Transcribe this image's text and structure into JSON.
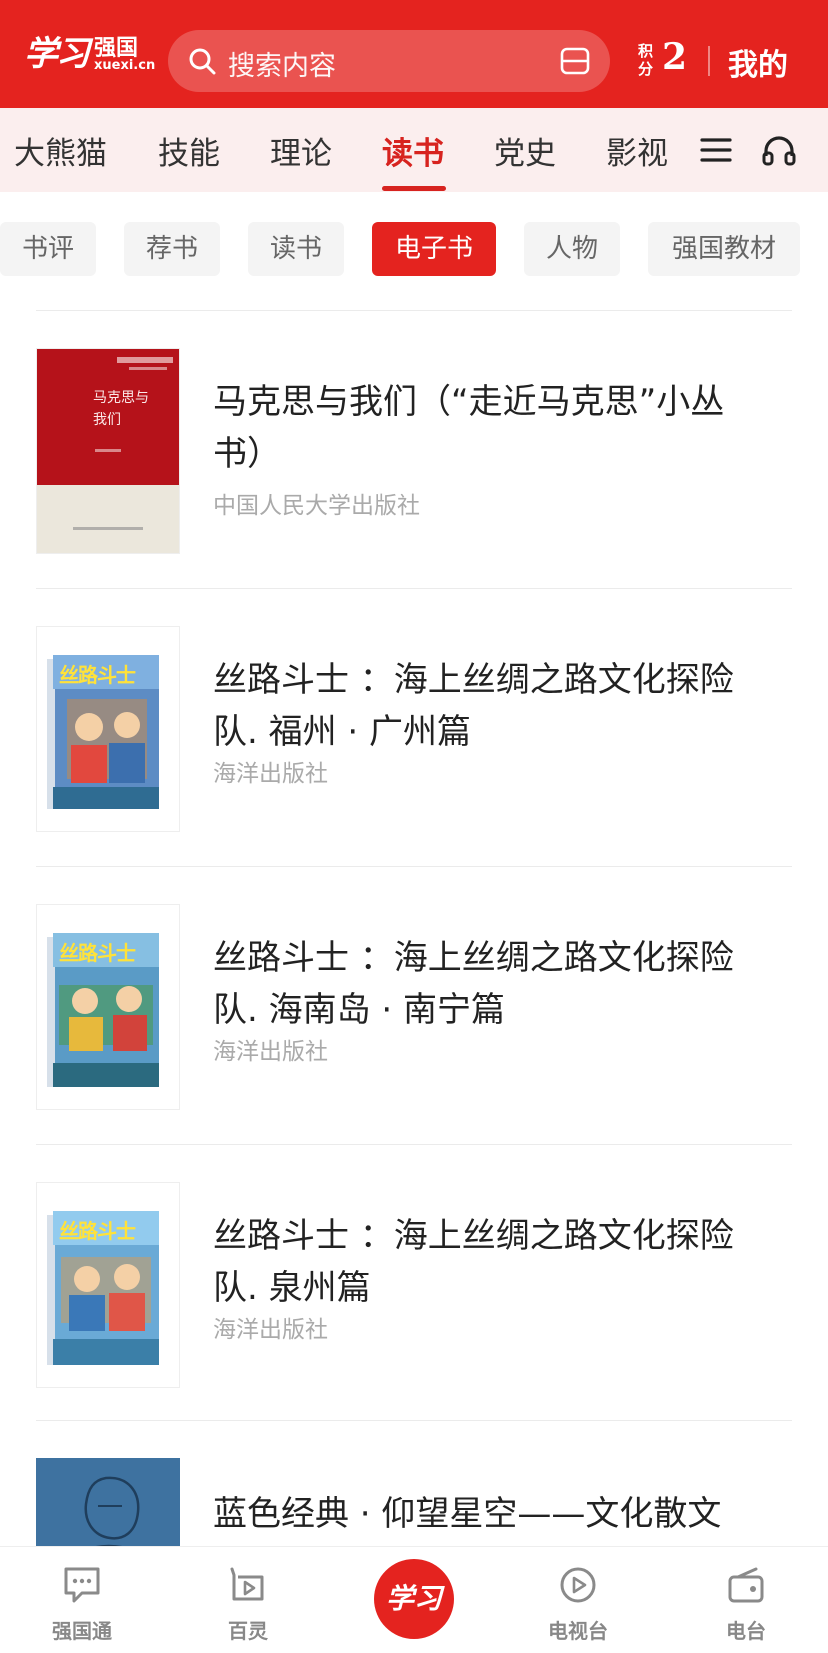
{
  "header": {
    "logo_script": "学习",
    "logo_brand": "强国",
    "logo_domain": "xuexi.cn",
    "search_placeholder": "搜索内容",
    "points_label": "积分",
    "points_value": "2",
    "mine_label": "我的",
    "brand_color": "#e4231f"
  },
  "tabs": [
    {
      "label": "大熊猫"
    },
    {
      "label": "技能"
    },
    {
      "label": "理论"
    },
    {
      "label": "读书",
      "active": true
    },
    {
      "label": "党史"
    },
    {
      "label": "影视"
    }
  ],
  "chips": [
    {
      "label": "书评"
    },
    {
      "label": "荐书"
    },
    {
      "label": "读书"
    },
    {
      "label": "电子书",
      "active": true
    },
    {
      "label": "人物"
    },
    {
      "label": "强国教材"
    }
  ],
  "books": [
    {
      "title": "马克思与我们（“走近马克思”小丛书）",
      "publisher": "中国人民大学出版社",
      "cover_title": "马克思与我们",
      "cover": "red-cover"
    },
    {
      "title": "丝路斗士 ：海上丝绸之路文化探险队. 福州 · 广州篇",
      "publisher": "海洋出版社",
      "cover_title": "丝路斗士",
      "cover": "comic-cover"
    },
    {
      "title": "丝路斗士 ：海上丝绸之路文化探险队. 海南岛 · 南宁篇",
      "publisher": "海洋出版社",
      "cover_title": "丝路斗士",
      "cover": "comic-cover"
    },
    {
      "title": "丝路斗士 ：海上丝绸之路文化探险队. 泉州篇",
      "publisher": "海洋出版社",
      "cover_title": "丝路斗士",
      "cover": "comic-cover"
    },
    {
      "title": "蓝色经典 · 仰望星空——文化散文",
      "publisher": "",
      "cover_title": "",
      "cover": "blue-cover"
    }
  ],
  "bottom_nav": [
    {
      "label": "强国通",
      "icon": "chat-icon"
    },
    {
      "label": "百灵",
      "icon": "video-icon"
    },
    {
      "label": "学习",
      "icon": "xuexi-logo"
    },
    {
      "label": "电视台",
      "icon": "play-icon"
    },
    {
      "label": "电台",
      "icon": "radio-icon"
    }
  ]
}
